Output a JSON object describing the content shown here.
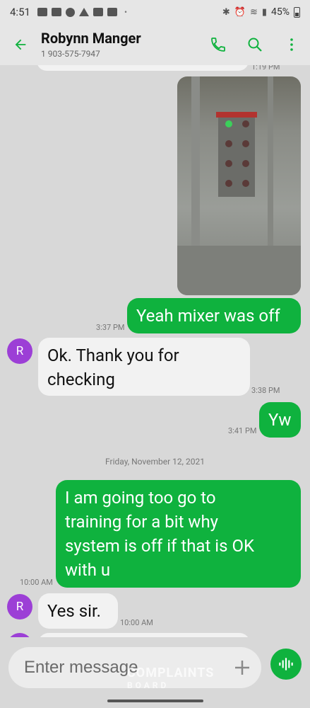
{
  "status_bar": {
    "time": "4:51",
    "battery": "45%"
  },
  "contact": {
    "name": "Robynn Manger",
    "phone": "1 903-575-7947",
    "avatar_initial": "R"
  },
  "messages": [
    {
      "dir": "out",
      "type": "image",
      "time": "1:19 PM"
    },
    {
      "dir": "out",
      "text": "Yeah mixer was off",
      "time": "3:37 PM"
    },
    {
      "dir": "in",
      "text_lines": [
        "Ok. Thank you for",
        "checking"
      ],
      "time": "3:38 PM"
    },
    {
      "dir": "out",
      "text": "Yw",
      "time": "3:41 PM"
    },
    {
      "type": "date",
      "text": "Friday, November 12, 2021"
    },
    {
      "dir": "out",
      "text_lines": [
        "I am going too go to",
        "training for a bit why",
        "system is off if that is OK",
        "with u"
      ],
      "time": "10:00 AM"
    },
    {
      "dir": "in",
      "text": "Yes sir.",
      "time": "10:00 AM"
    }
  ],
  "composer": {
    "placeholder": "Enter message"
  },
  "watermark": {
    "line1": "COMPLAINTS",
    "line2": "BOARD"
  },
  "colors": {
    "accent": "#0fb23e",
    "avatar": "#9c3fd6"
  }
}
